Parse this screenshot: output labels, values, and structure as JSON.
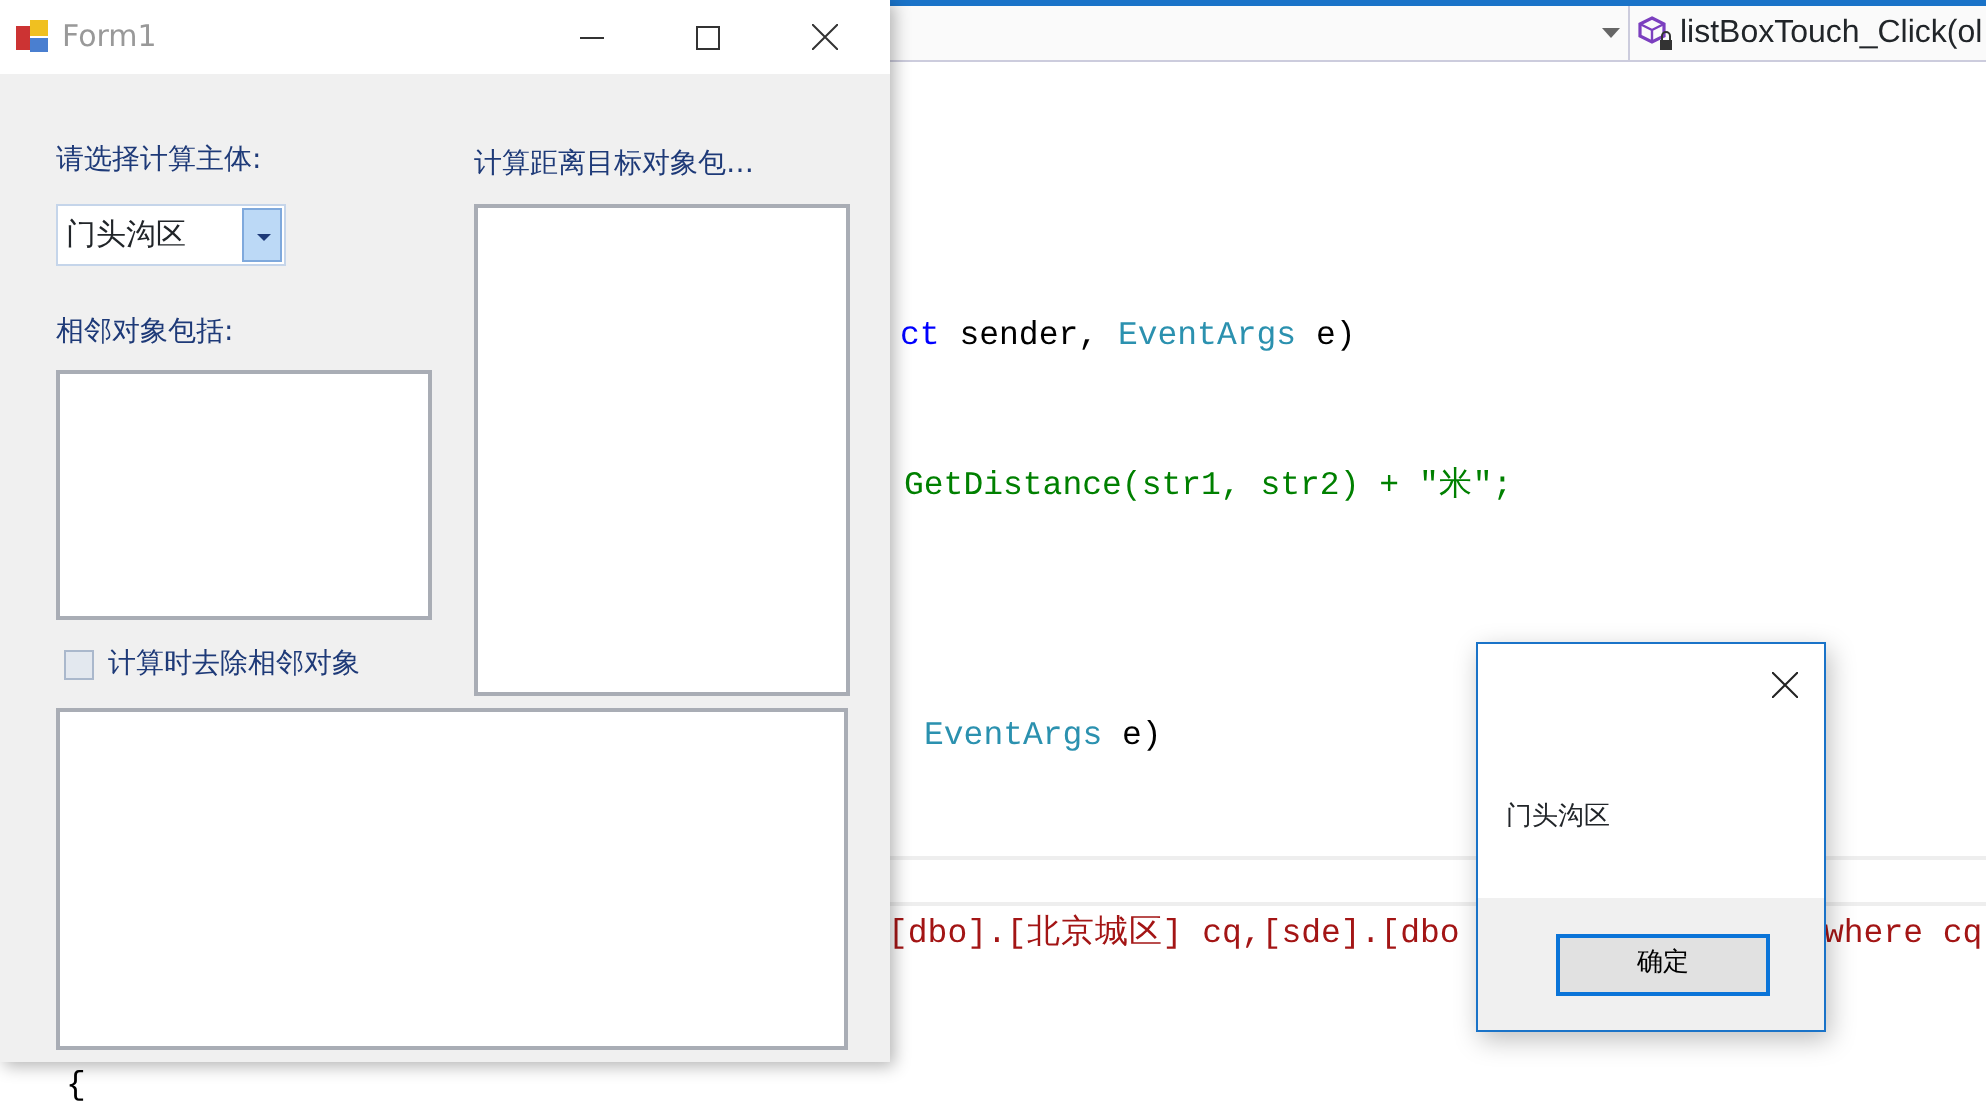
{
  "ide": {
    "member_dropdown": {
      "value": "listBoxTouch_Click(ol"
    },
    "code_lines": [
      {
        "segments": [
          {
            "text": "ct",
            "kind": "keyword"
          },
          {
            "text": " sender, ",
            "kind": "plain"
          },
          {
            "text": "EventArgs",
            "kind": "type"
          },
          {
            "text": " e)",
            "kind": "plain"
          }
        ]
      },
      {
        "segments": [
          {
            "text": "GetDistance(str1, str2) + \"米\";",
            "kind": "comment"
          }
        ]
      },
      {
        "segments": [
          {
            "text": "EventArgs",
            "kind": "type"
          },
          {
            "text": " e)",
            "kind": "plain"
          }
        ]
      },
      {
        "segments": [
          {
            "text": "[dbo].[北京城区] cq,[sde].[dbo",
            "kind": "string"
          }
        ],
        "tail": {
          "text": "where cq",
          "kind": "string"
        }
      },
      {
        "segments": [
          {
            "text": "{",
            "kind": "plain"
          }
        ]
      }
    ]
  },
  "form": {
    "title": "Form1",
    "subject_label": "请选择计算主体:",
    "subject_combo": {
      "value": "门头沟区"
    },
    "target_label": "计算距离目标对象包…",
    "adjacent_label": "相邻对象包括:",
    "exclude_checkbox": {
      "label": "计算时去除相邻对象",
      "checked": false
    }
  },
  "message_box": {
    "message": "门头沟区",
    "button": "确定"
  }
}
